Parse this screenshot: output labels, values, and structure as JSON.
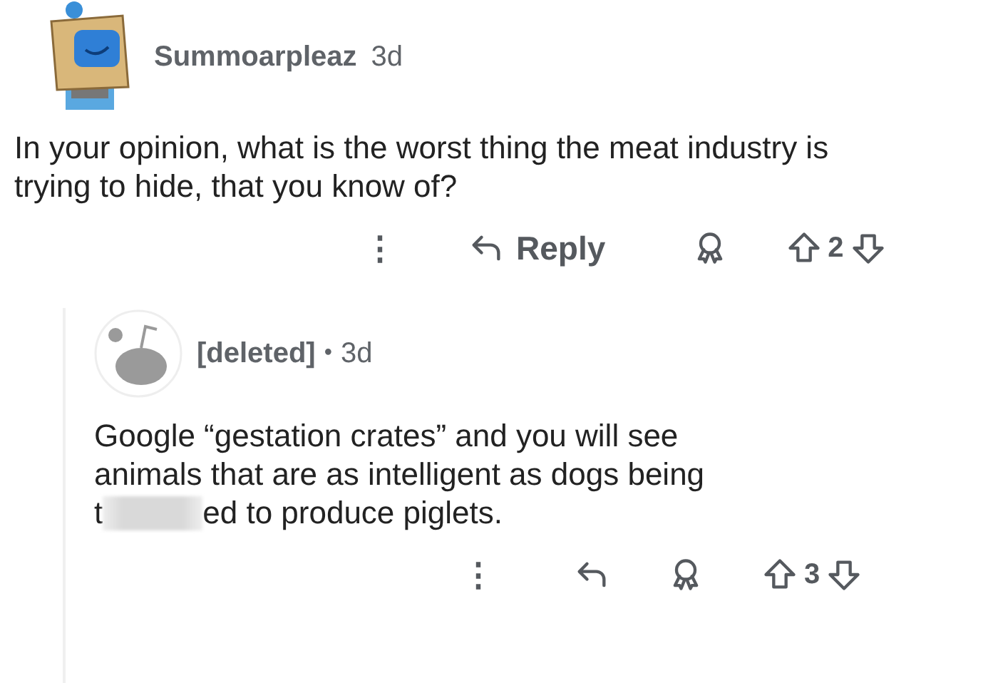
{
  "post_comment": {
    "author": "Summoarpleaz",
    "age": "3d",
    "body": "In your opinion, what is the worst thing the meat industry is trying to hide, that you know of?",
    "actions": {
      "more": "⋮",
      "reply": "Reply",
      "score": "2"
    }
  },
  "reply_comment": {
    "author": "[deleted]",
    "separator": "•",
    "age": "3d",
    "body_lines": [
      "Google “gestation crates” and you will see",
      "animals that are as intelligent as dogs being"
    ],
    "body_before": "t",
    "redacted": true,
    "body_after": "ed to produce piglets.",
    "actions": {
      "more": "⋮",
      "score": "3"
    }
  }
}
